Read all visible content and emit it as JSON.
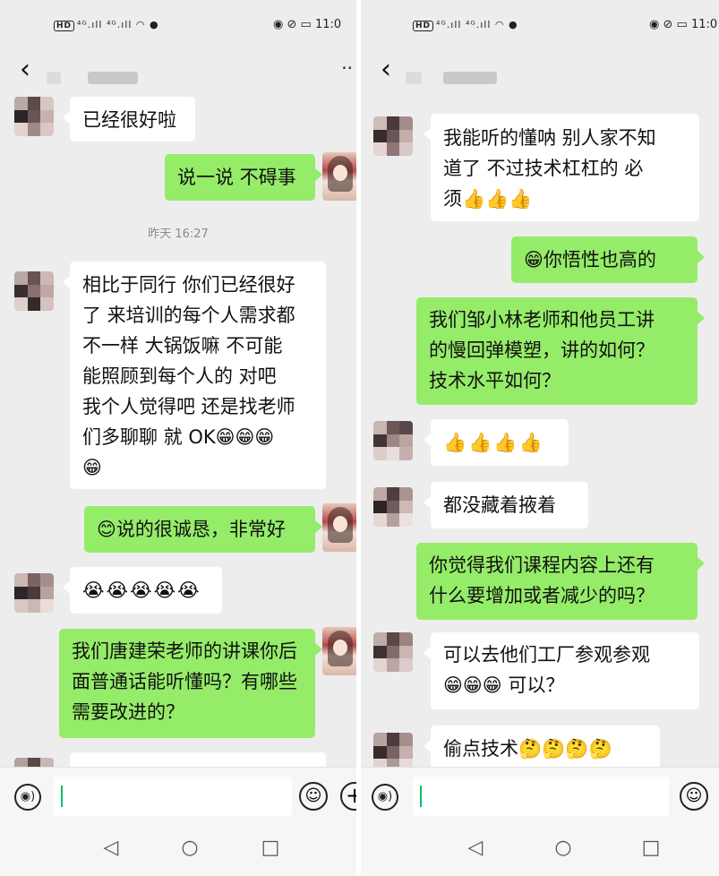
{
  "status_bar": {
    "hd_badge": "HD",
    "signal": "⁴ᴳ.ıll ⁴ᴳ.ıll",
    "time_left": "11:0",
    "time_right": "11:0"
  },
  "chat_header": {
    "back_icon": "chevron-left-icon",
    "more_label": "··"
  },
  "left_chat": {
    "msg1": "已经很好啦",
    "msg2": "说一说 不碍事",
    "timestamp": "昨天 16:27",
    "msg3_lines": [
      "相比于同行  你们已经很好",
      "了   来培训的每个人需求都",
      "不一样    大锅饭嘛    不可能",
      "能照顾到每个人的    对吧",
      "我个人觉得吧    还是找老师",
      "们多聊聊    就 OK😁😁😁",
      "😁"
    ],
    "msg4_emoji": "😊",
    "msg4_text": "说的很诚恳，非常好",
    "msg5": "😭😭😭😭😭",
    "msg6_lines": [
      "我们唐建荣老师的讲课你后",
      "面普通话能听懂吗？有哪些",
      "需要改进的？"
    ]
  },
  "right_chat": {
    "msg1_lines": [
      "我能听的懂呐    别人家不知",
      "道了     不过技术杠杠的   必",
      "须👍👍👍"
    ],
    "msg2_emoji": "😁",
    "msg2_text": "你悟性也高的",
    "msg3_lines": [
      "我们邹小林老师和他员工讲",
      "的慢回弹模塑，讲的如何？",
      "技术水平如何？"
    ],
    "msg4": "👍👍👍👍",
    "msg5": "都没藏着掖着",
    "msg6_lines": [
      "你觉得我们课程内容上还有",
      "什么要增加或者减少的吗？"
    ],
    "msg7_lines": [
      "可以去他们工厂参观参观",
      "😁😁😁     可以？"
    ],
    "msg8": "偷点技术🤔🤔🤔🤔"
  },
  "input_bar": {
    "voice_icon": "voice-icon",
    "emoji_icon": "emoji-icon",
    "plus_icon": "plus-icon",
    "voice_glyph": "◉)",
    "emoji_glyph": "☺",
    "plus_glyph": "+"
  },
  "system_nav": {
    "back": "◁",
    "home": "○",
    "recents": "□"
  },
  "colors": {
    "chat_bg": "#ededed",
    "outgoing_bubble": "#95ec69",
    "incoming_bubble": "#ffffff",
    "caret": "#07c160"
  }
}
